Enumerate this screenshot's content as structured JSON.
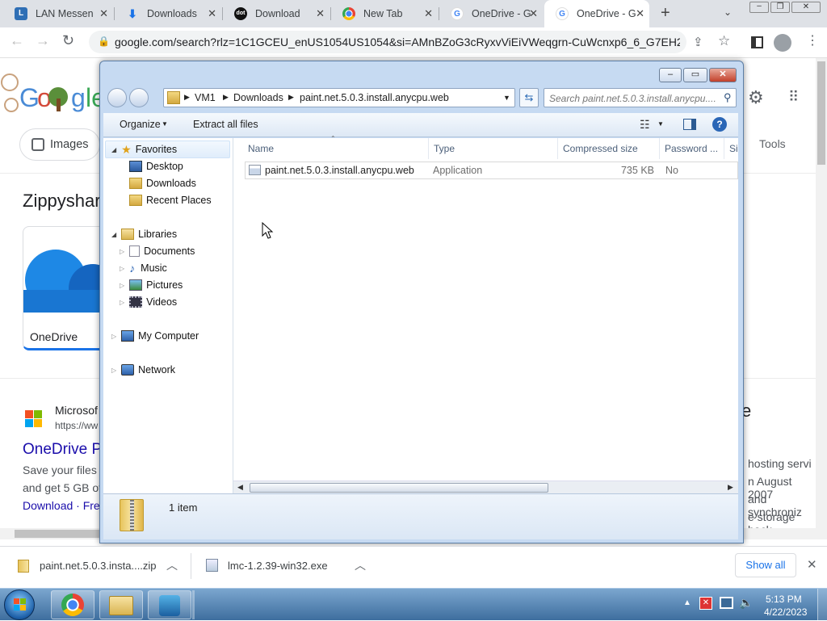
{
  "chrome": {
    "tabs": [
      {
        "title": "LAN Messen",
        "icon": "lan-messenger-icon"
      },
      {
        "title": "Downloads",
        "icon": "download-icon"
      },
      {
        "title": "Download",
        "icon": "dot-site-icon"
      },
      {
        "title": "New Tab",
        "icon": "chrome-icon"
      },
      {
        "title": "OneDrive - G",
        "icon": "google-g-icon"
      },
      {
        "title": "OneDrive - G",
        "icon": "google-g-icon"
      }
    ],
    "new_tab_symbol": "+",
    "tab_close_symbol": "✕",
    "url": "google.com/search?rlz=1C1GCEU_enUS1054US1054&si=AMnBZoG3cRyxvViEiVWeqgrn-CuWcnxp6_6_G7EH225..."
  },
  "google_page": {
    "images_chip": "Images",
    "tools_label": "Tools",
    "heading_partial": "Zippyshar",
    "onedrive_card_label": "OneDrive",
    "result_source": "Microsof",
    "result_url": "https://ww",
    "result_title": "OneDrive P",
    "result_snippet_1": "Save your files",
    "result_snippet_2": "and get 5 GB of",
    "result_links": "Download · Fre",
    "right_heading": "e",
    "right_text_1": "hosting servi",
    "right_text_2": "n August 2007",
    "right_text_3": "and synchroniz",
    "right_text_4": "e storage back"
  },
  "explorer": {
    "breadcrumb": [
      "VM1",
      "Downloads",
      "paint.net.5.0.3.install.anycpu.web"
    ],
    "search_placeholder": "Search paint.net.5.0.3.install.anycpu....",
    "commands": {
      "organize": "Organize",
      "extract": "Extract all files"
    },
    "nav": {
      "favorites": "Favorites",
      "favorites_items": [
        "Desktop",
        "Downloads",
        "Recent Places"
      ],
      "libraries": "Libraries",
      "library_items": [
        "Documents",
        "Music",
        "Pictures",
        "Videos"
      ],
      "computer": "My Computer",
      "network": "Network"
    },
    "columns": [
      "Name",
      "Type",
      "Compressed size",
      "Password ...",
      "Si"
    ],
    "files": [
      {
        "name": "paint.net.5.0.3.install.anycpu.web",
        "type": "Application",
        "size": "735 KB",
        "password": "No"
      }
    ],
    "item_count": "1 item"
  },
  "downloads_shelf": {
    "items": [
      "paint.net.5.0.3.insta....zip",
      "lmc-1.2.39-win32.exe"
    ],
    "show_all": "Show all"
  },
  "taskbar": {
    "time": "5:13 PM",
    "date": "4/22/2023"
  },
  "colors": {
    "google_link": "#1a0dab",
    "explorer_frame": "#c6daf2",
    "taskbar": "#4b7db0"
  }
}
